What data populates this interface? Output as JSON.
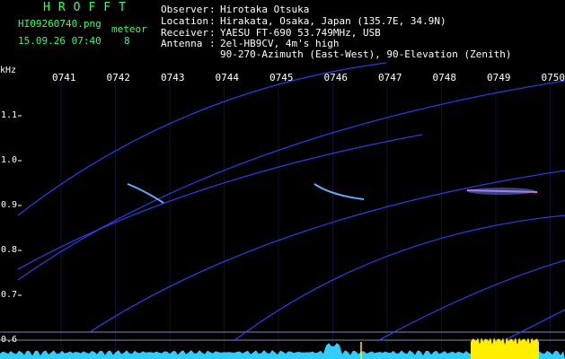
{
  "app": {
    "logo": "HROFFT",
    "filename": "HI09260740.png",
    "datetime": "15.09.26 07:40",
    "meteor_label": "meteor",
    "meteor_count": "8"
  },
  "info": {
    "observer_label": "Observer",
    "observer": "Hirotaka Otsuka",
    "location_label": "Location",
    "location": "Hirakata, Osaka, Japan (135.7E, 34.9N)",
    "receiver_label": "Receiver",
    "receiver": "YAESU FT-690 53.749MHz, USB",
    "antenna_label": "Antenna",
    "antenna_line1": "2el-HB9CV, 4m's high",
    "antenna_line2": "90-270-Azimuth (East-West), 90-Elevation (Zenith)"
  },
  "colors": {
    "background": "#000000",
    "header_green": "#33ff66",
    "trace_blue": "#3344ff",
    "spectrum_cyan": "#33ccff",
    "spectrum_yellow": "#ffee00"
  },
  "chart_data": {
    "type": "spectrogram",
    "ylabel": "kHz",
    "x_ticks": [
      "0741",
      "0742",
      "0743",
      "0744",
      "0745",
      "0746",
      "0747",
      "0748",
      "0749",
      "0750"
    ],
    "y_ticks": [
      "1.1",
      "1.0",
      "0.9",
      "0.8",
      "0.7",
      "0.6"
    ],
    "ylim": [
      0.58,
      1.2
    ]
  }
}
